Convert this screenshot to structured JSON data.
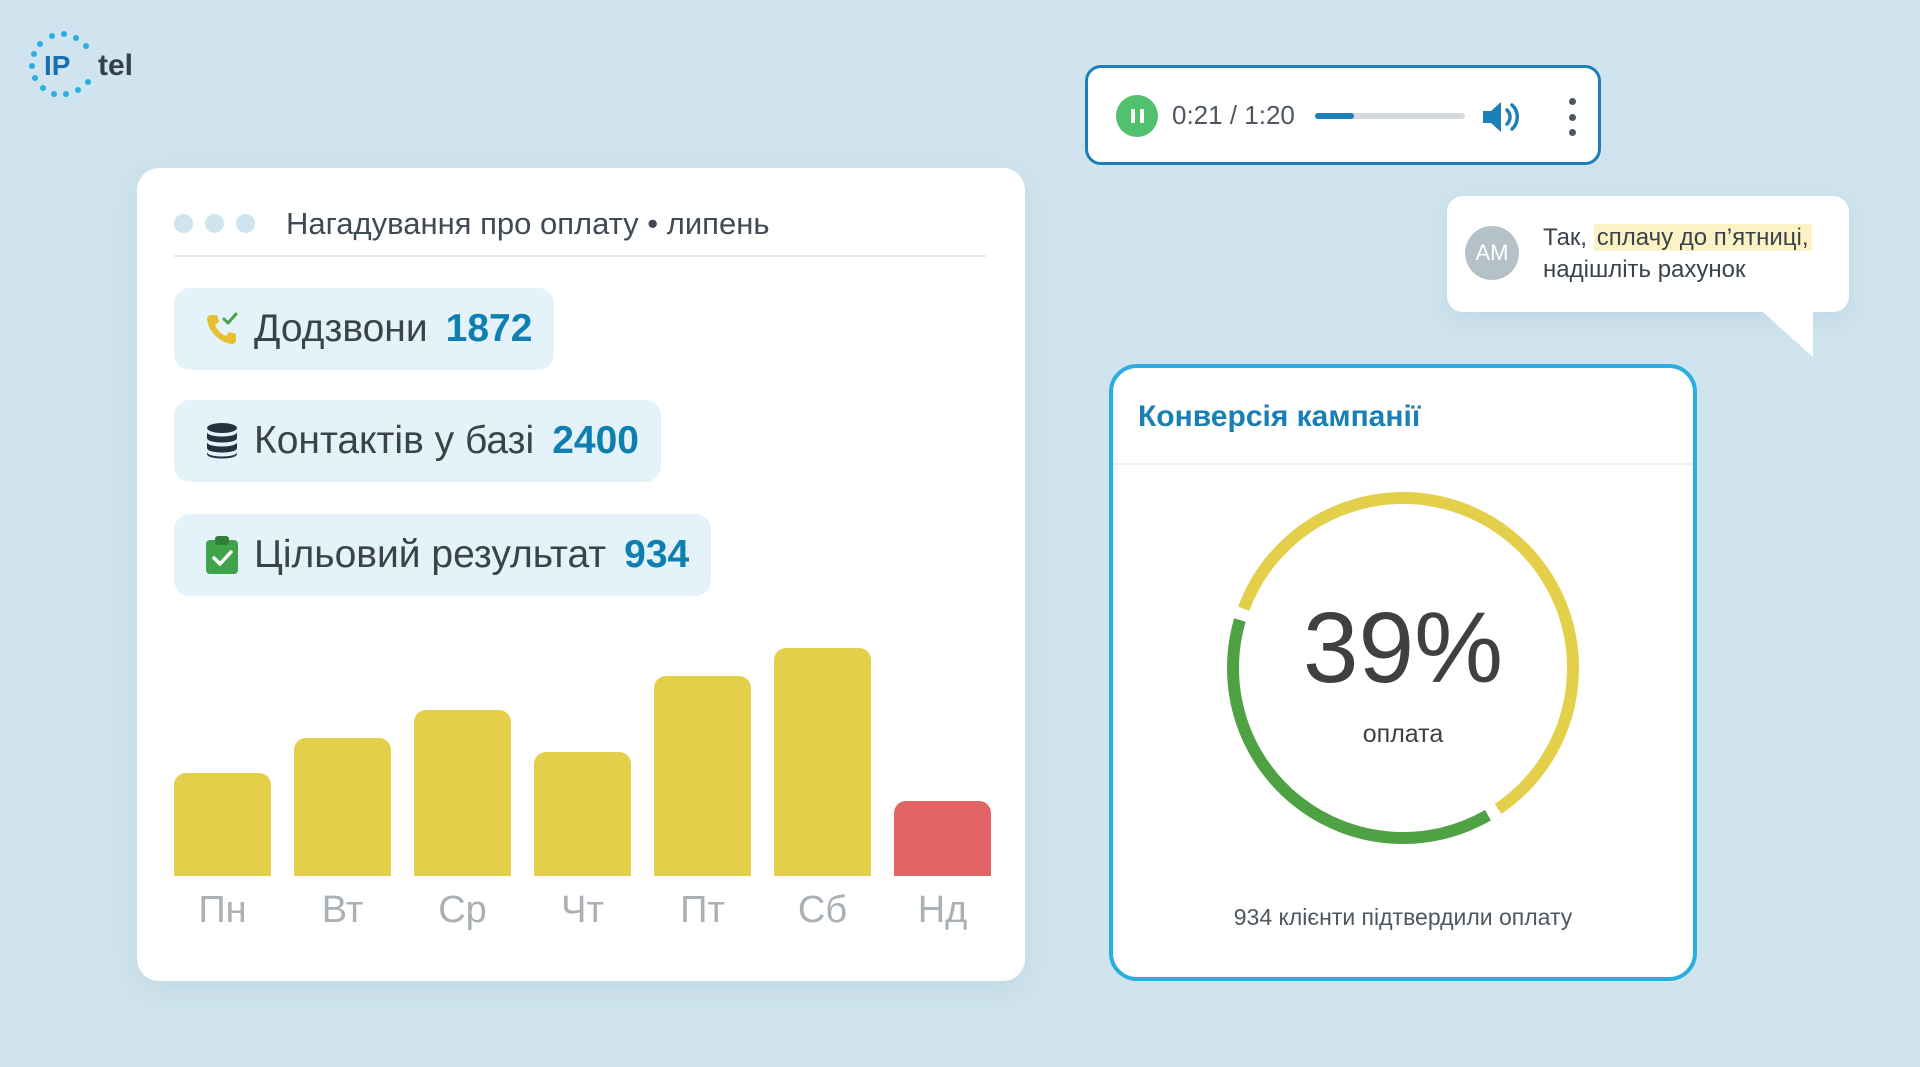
{
  "logo": {
    "text_ip": "IP",
    "text_tel": "tel"
  },
  "card": {
    "title": "Нагадування  про оплату • липень",
    "stats": [
      {
        "icon": "phone-check-icon",
        "label": "Додзвони",
        "value": "1872"
      },
      {
        "icon": "database-icon",
        "label": "Контактів у базі",
        "value": "2400"
      },
      {
        "icon": "clipboard-check-icon",
        "label": "Цільовий результат",
        "value": "934"
      }
    ]
  },
  "chart_data": {
    "type": "bar",
    "categories": [
      "Пн",
      "Вт",
      "Ср",
      "Чт",
      "Пт",
      "Сб",
      "Нд"
    ],
    "values": [
      102,
      136,
      164,
      122,
      197,
      225,
      74
    ],
    "colors": [
      "#e4cf4b",
      "#e4cf4b",
      "#e4cf4b",
      "#e4cf4b",
      "#e4cf4b",
      "#e4cf4b",
      "#e26465"
    ],
    "ylim": [
      0,
      225
    ],
    "grid": false
  },
  "player": {
    "time": "0:21 / 1:20",
    "progress": 0.26
  },
  "chat": {
    "avatar": "AM",
    "prefix": "Так, ",
    "highlight": "сплачу до п’ятниці,",
    "suffix": "надішліть рахунок"
  },
  "conversion": {
    "title": "Конверсія кампанії",
    "percent_label": "39%",
    "percent": 39,
    "sub": "оплата",
    "footer": "934 клієнти підтвердили оплату",
    "colors": {
      "done": "#4fa244",
      "rest": "#e4cf4b"
    }
  },
  "colors": {
    "background": "#cfe4ee",
    "accent": "#0f7fb0",
    "border": "#2aaee0"
  }
}
